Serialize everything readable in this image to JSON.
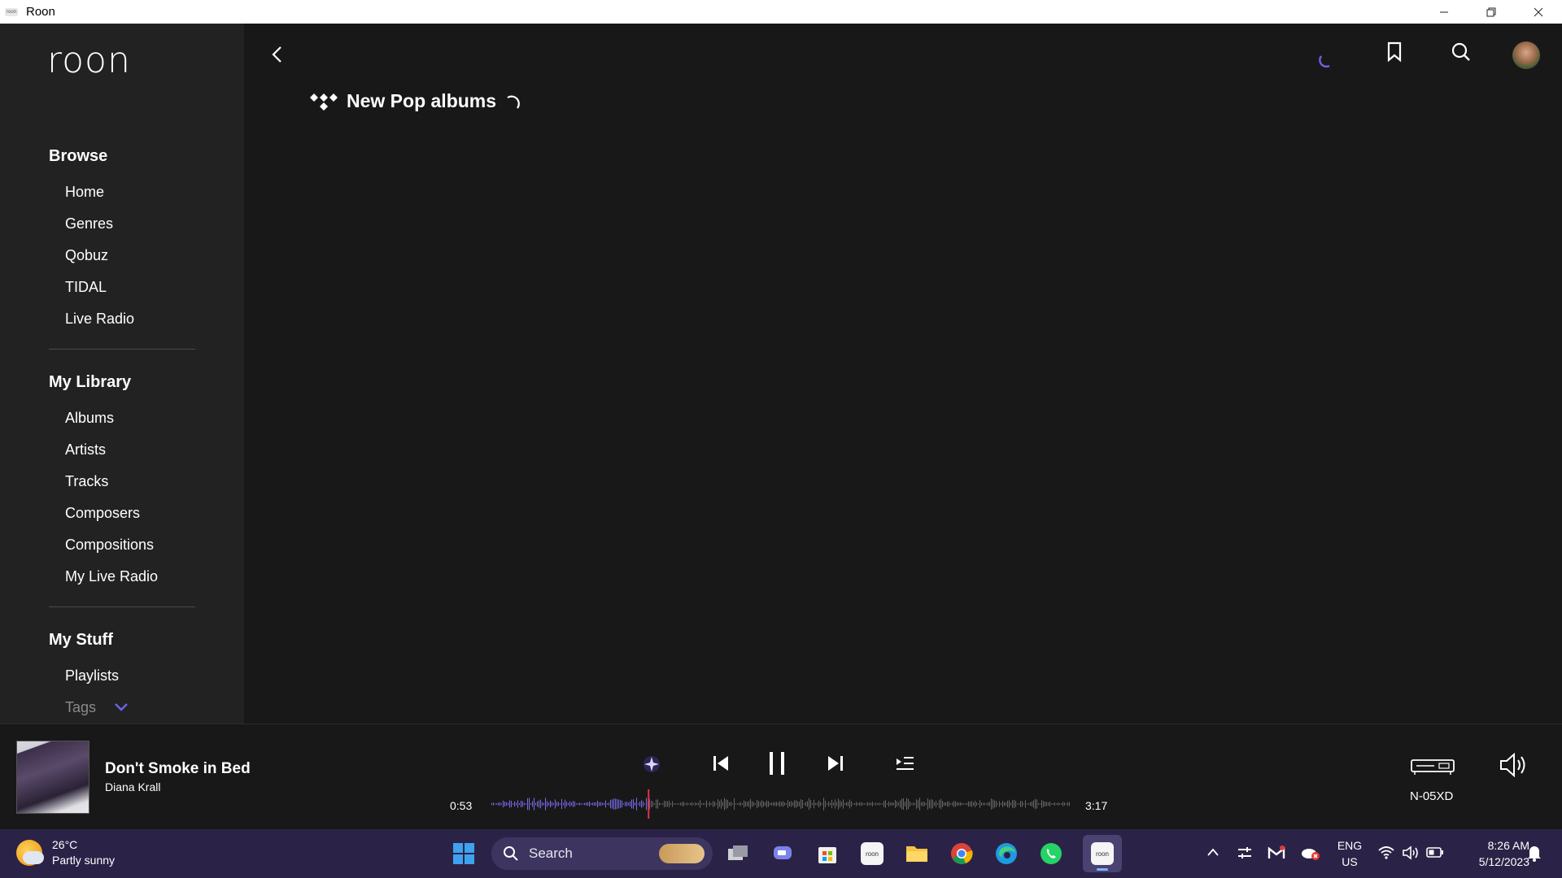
{
  "window": {
    "title": "Roon",
    "app_icon_text": "roon",
    "buttons": {
      "minimize": "—",
      "restore": "❐",
      "close": "✕"
    }
  },
  "sidebar": {
    "logo": "roon",
    "sections": [
      {
        "title": "Browse",
        "items": [
          "Home",
          "Genres",
          "Qobuz",
          "TIDAL",
          "Live Radio"
        ]
      },
      {
        "title": "My Library",
        "items": [
          "Albums",
          "Artists",
          "Tracks",
          "Composers",
          "Compositions",
          "My Live Radio"
        ]
      },
      {
        "title": "My Stuff",
        "items": [
          "Playlists"
        ]
      }
    ],
    "tags_label": "Tags"
  },
  "main": {
    "page_title": "New Pop albums",
    "source_icon": "tidal-icon",
    "loading": true
  },
  "player": {
    "track_title": "Don't Smoke in Bed",
    "artist": "Diana Krall",
    "elapsed": "0:53",
    "duration": "3:17",
    "progress_fraction": 0.27,
    "zone_name": "N-05XD",
    "state": "playing",
    "accent_color": "#7b6cf0",
    "playhead_color": "#e0334d"
  },
  "taskbar": {
    "weather": {
      "temp": "26°C",
      "condition": "Partly sunny"
    },
    "search_placeholder": "Search",
    "language": "ENG",
    "region": "US",
    "time": "8:26 AM",
    "date": "5/12/2023",
    "background_color": "#2b2347"
  }
}
